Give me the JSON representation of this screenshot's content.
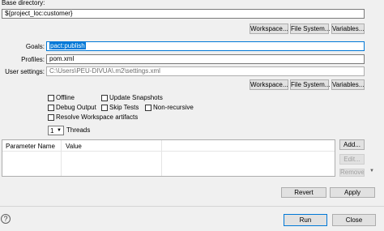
{
  "base_directory": {
    "label": "Base directory:",
    "value": "${project_loc:customer}"
  },
  "base_buttons": {
    "workspace": "Workspace...",
    "file_system": "File System...",
    "variables": "Variables..."
  },
  "goals": {
    "label": "Goals:",
    "value": "pact:publish"
  },
  "profiles": {
    "label": "Profiles:",
    "value": "pom.xml"
  },
  "user_settings": {
    "label": "User settings:",
    "value": "C:\\Users\\PEU-DIVUA\\.m2\\settings.xml"
  },
  "settings_buttons": {
    "workspace": "Workspace...",
    "file_system": "File System...",
    "variables": "Variables..."
  },
  "options": {
    "offline": "Offline",
    "update_snapshots": "Update Snapshots",
    "debug_output": "Debug Output",
    "skip_tests": "Skip Tests",
    "non_recursive": "Non-recursive",
    "resolve_workspace": "Resolve Workspace artifacts"
  },
  "threads": {
    "value": "1",
    "label": "Threads"
  },
  "param_table": {
    "columns": [
      "Parameter Name",
      "Value"
    ]
  },
  "param_buttons": {
    "add": "Add...",
    "edit": "Edit...",
    "remove": "Remove"
  },
  "footer": {
    "revert": "Revert",
    "apply": "Apply",
    "run": "Run",
    "close": "Close",
    "help": "?"
  }
}
